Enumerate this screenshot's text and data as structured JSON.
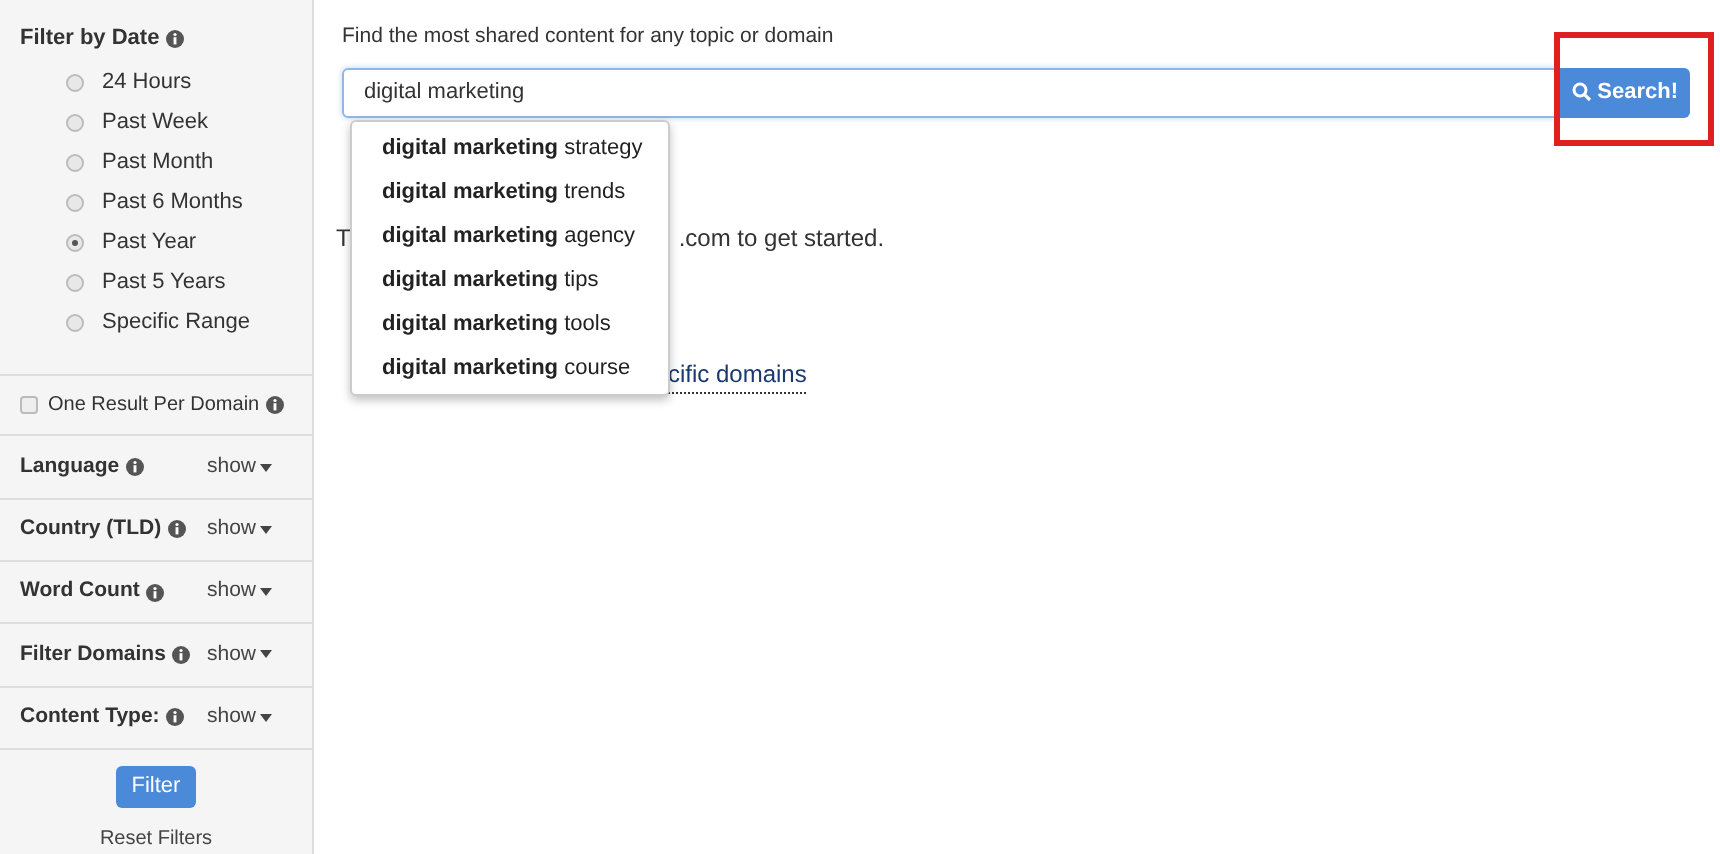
{
  "sidebar": {
    "date_filter": {
      "title": "Filter by Date",
      "options": [
        {
          "label": "24 Hours",
          "selected": false
        },
        {
          "label": "Past Week",
          "selected": false
        },
        {
          "label": "Past Month",
          "selected": false
        },
        {
          "label": "Past 6 Months",
          "selected": false
        },
        {
          "label": "Past Year",
          "selected": true
        },
        {
          "label": "Past 5 Years",
          "selected": false
        },
        {
          "label": "Specific Range",
          "selected": false
        }
      ]
    },
    "one_result_per_domain": {
      "label": "One Result Per Domain",
      "checked": false
    },
    "sections": [
      {
        "title": "Language",
        "toggle": "show"
      },
      {
        "title": "Country (TLD)",
        "toggle": "show"
      },
      {
        "title": "Word Count",
        "toggle": "show"
      },
      {
        "title": "Filter Domains",
        "toggle": "show"
      },
      {
        "title": "Content Type:",
        "toggle": "show"
      }
    ],
    "filter_button": "Filter",
    "reset_link": "Reset Filters"
  },
  "main": {
    "prompt": "Find the most shared content for any topic or domain",
    "search": {
      "value": "digital marketing"
    },
    "search_button": "Search!",
    "hidden_line_start": "T",
    "hidden_line_end": ".com to get started.",
    "hidden_link": "cific domains",
    "suggestions": [
      "**digital marketing** strategy",
      "**digital marketing** trends",
      "**digital marketing** agency",
      "**digital marketing** tips",
      "**digital marketing** tools",
      "**digital marketing** course"
    ]
  }
}
